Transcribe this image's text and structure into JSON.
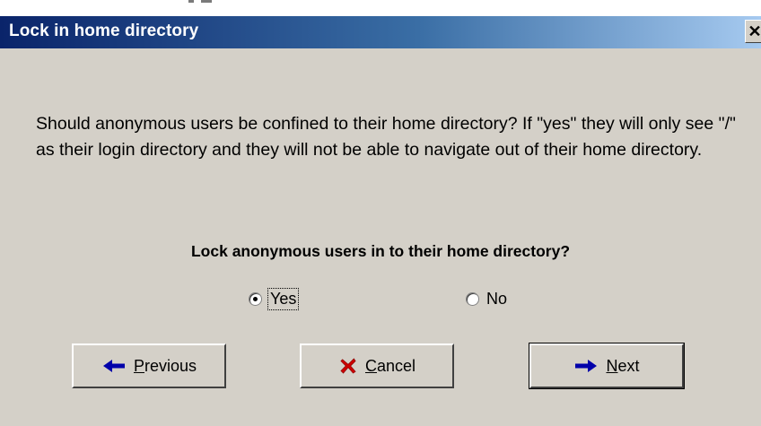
{
  "window": {
    "title": "Lock in home directory",
    "close_glyph": "✕"
  },
  "content": {
    "description": "Should anonymous users be confined to their home directory? If \"yes\" they will only see \"/\" as their login directory and they will not be able to navigate out of their home directory.",
    "question": "Lock anonymous users in to their home directory?"
  },
  "options": {
    "selected": "Yes",
    "yes": {
      "label": "Yes",
      "checked": true
    },
    "no": {
      "label": "No",
      "checked": false
    }
  },
  "buttons": {
    "previous": {
      "mnemonic": "P",
      "rest": "revious",
      "icon": "arrow-left-icon"
    },
    "cancel": {
      "mnemonic": "C",
      "rest": "ancel",
      "icon": "red-x-icon"
    },
    "next": {
      "mnemonic": "N",
      "rest": "ext",
      "icon": "arrow-right-icon"
    }
  },
  "colors": {
    "titlebar_start": "#0a246a",
    "titlebar_end": "#a6caf0",
    "face": "#d4d0c8",
    "arrow": "#0000aa",
    "cancel_x": "#cc0000"
  }
}
